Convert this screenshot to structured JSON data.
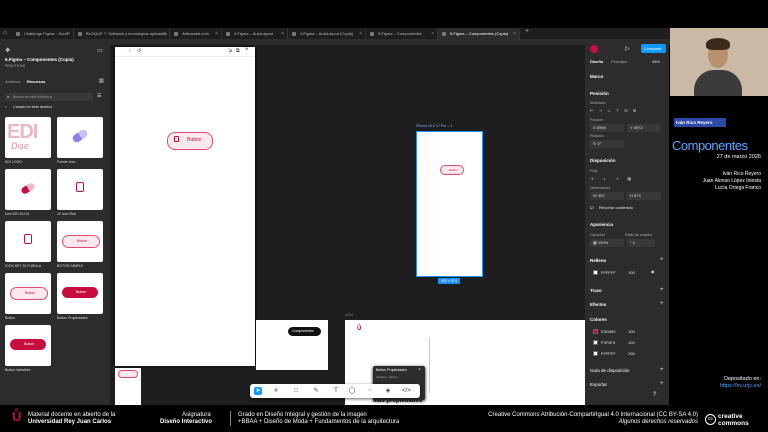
{
  "tabs": [
    {
      "label": "Challenge Figma – Scott"
    },
    {
      "label": "BLOQUE 7: Software y tecnologías aplicadas"
    },
    {
      "label": "Artboardsl.com"
    },
    {
      "label": "4.Figma – AutoLayout"
    },
    {
      "label": "4.Figma – AutoLayout (Copia)"
    },
    {
      "label": "5.Figma – Componentes"
    },
    {
      "label": "5.Figma – Componentes (Copia)",
      "active": true
    }
  ],
  "left_panel": {
    "file_name": "5.Figma – Componentes (Copia)",
    "project": "PRÁCTICAS",
    "tab_files": "Archivos",
    "tab_assets": "Recursos",
    "search_placeholder": "Buscar en esta biblioteca",
    "section_title": "Creado en este archivo",
    "assets": [
      {
        "label": "EDI LOGO"
      },
      {
        "label": "Fuente Icon"
      },
      {
        "label": "Icon EDI 24×24"
      },
      {
        "label": "22 Icon Red"
      },
      {
        "label": "ICON SET 32 FUENLA"
      },
      {
        "label": "BOTÓN SIMPLE"
      },
      {
        "label": "Button"
      },
      {
        "label": "Button Propiedades"
      },
      {
        "label": "Button Variables"
      }
    ],
    "button_text": "Button"
  },
  "canvas": {
    "prototype_button": "Button",
    "frame_title": "iPhone 16 & 17 Pro – 1",
    "frame_button": "Button",
    "frame_size": "402 × 874",
    "small_frame_button": "Componentes",
    "variant_popup_title": "Button Propiedades",
    "variant_popup_sub": "Instance options",
    "frame3_text": "Más propiedades"
  },
  "right_panel": {
    "tab_design": "Diseño",
    "tab_prototype": "Prototipo",
    "zoom": "45%",
    "share_button": "Compartir",
    "frame_label": "Marco",
    "position_title": "Posición",
    "alignment_label": "Alineación",
    "position_label": "Posición",
    "x_value": "6998",
    "y_value": "5972",
    "rotation_label": "Rotación",
    "rotation_value": "0°",
    "layout_title": "Disposición",
    "flow_label": "Flujo",
    "dimensions_label": "Dimensiones",
    "w_value": "402",
    "h_value": "874",
    "clip_label": "Recortar contenido",
    "appearance_title": "Apariencia",
    "opacity_label": "Opacidad",
    "opacity_value": "100%",
    "radius_label": "Radio de esquina",
    "radius_value": "0",
    "fill_title": "Relleno",
    "fill_hex": "FFFFFF",
    "fill_pct": "100",
    "stroke_title": "Trazo",
    "effects_title": "Efectos",
    "colors_title": "Colores",
    "colors": [
      {
        "hex": "E5D053",
        "pct": "100",
        "swatch": "#c70f3f"
      },
      {
        "hex": "F3F3F3",
        "pct": "100",
        "swatch": "#f3f3f3"
      },
      {
        "hex": "FFFFFF",
        "pct": "100",
        "swatch": "#ffffff"
      }
    ],
    "layout_guide_title": "Guía de disposición",
    "export_title": "Exportar"
  },
  "slide": {
    "presenter_tag": "Iván Rico Reyero",
    "title": "Componentes",
    "date": "27 de marzo 2026",
    "authors": [
      "Iván Rico Reyero",
      "Juan Alonso López Iniesta",
      "Lucía Ortega Franco"
    ],
    "deposit_label": "Depositado en:",
    "deposit_url": "https://hv.urjc.es/"
  },
  "footer": {
    "material_line1": "Material docente en abierto de la",
    "material_line2": "Universidad Rey Juan Carlos",
    "subject_label": "Asignatura",
    "subject": "Diseño Interactivo",
    "degree_line1": "Grado en Diseño Integral y gestión de la imagen",
    "degree_line2": "+BBAA + Diseño de Moda + Fundamentos de la arquitectura",
    "license_line1": "Creative Commons Atribución-CompartirIgual 4.0 Internacional (CC BY-SA 4.0)",
    "license_line2": "Algunos derechos reservados",
    "cc_logo_line1": "creative",
    "cc_logo_line2": "commons"
  },
  "colors": {
    "accent_red": "#c70f3f",
    "figma_blue": "#0d99ff",
    "slide_blue": "#5aa8ff"
  }
}
